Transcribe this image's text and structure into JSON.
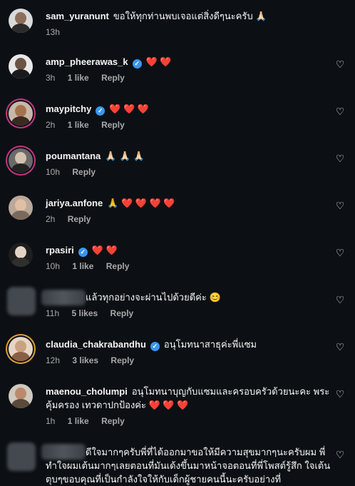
{
  "comments": [
    {
      "username": "sam_yuranunt",
      "verified": false,
      "text": "ขอให้ทุกท่านพบเจอแต่สิ่งดีๆนะครับ 🙏🏻",
      "time": "13h",
      "likes": "",
      "reply": ""
    },
    {
      "username": "amp_pheerawas_k",
      "verified": true,
      "text": "❤️ ❤️",
      "time": "3h",
      "likes": "1 like",
      "reply": "Reply"
    },
    {
      "username": "maypitchy",
      "verified": true,
      "text": "❤️ ❤️ ❤️",
      "time": "2h",
      "likes": "1 like",
      "reply": "Reply"
    },
    {
      "username": "poumantana",
      "verified": false,
      "text": "🙏🏻 🙏🏻 🙏🏻",
      "time": "10h",
      "likes": "",
      "reply": "Reply"
    },
    {
      "username": "jariya.anfone",
      "verified": false,
      "text": "🙏 ❤️ ❤️ ❤️ ❤️",
      "time": "2h",
      "likes": "",
      "reply": "Reply"
    },
    {
      "username": "rpasiri",
      "verified": true,
      "text": "❤️ ❤️",
      "time": "10h",
      "likes": "1 like",
      "reply": "Reply"
    },
    {
      "username": "",
      "verified": false,
      "text": "แล้วทุกอย่างจะผ่านไปด้วยดีค่ะ 😊",
      "time": "11h",
      "likes": "5 likes",
      "reply": "Reply"
    },
    {
      "username": "claudia_chakrabandhu",
      "verified": true,
      "text": "อนุโมทนาสาธุค่ะพี่แซม",
      "time": "12h",
      "likes": "3 likes",
      "reply": "Reply"
    },
    {
      "username": "maenou_cholumpi",
      "verified": false,
      "text": "อนุโมทนาบุญกับแซมและครอบครัวด้วยนะคะ พระคุ้มครอง เทวดาปกป้องค่ะ ❤️ ❤️ ❤️",
      "time": "1h",
      "likes": "1 like",
      "reply": "Reply"
    },
    {
      "username": "",
      "verified": false,
      "text": "ดีใจมากๆครับพี่ที่ได้ออกมาขอให้มีความสุขมากๆนะครับผม พี่ทำใจผมเต้นมากๆเลยตอนที่มันเด้งขึ้นมาหน้าจอตอนที่พี่โพสต์รู้สึก ใจเต้นตุบๆขอบคุณที่เป็นกำลังใจให้กับเด็กผู้ชายคนนี้นะครับอย่างที่",
      "time": "",
      "likes": "",
      "reply": ""
    }
  ],
  "icons": {
    "like": "heart-outline-icon",
    "verified": "verified-badge-icon"
  },
  "colors": {
    "background": "#0c1014",
    "verified": "#3897f0",
    "muted": "#a8a8a8"
  }
}
